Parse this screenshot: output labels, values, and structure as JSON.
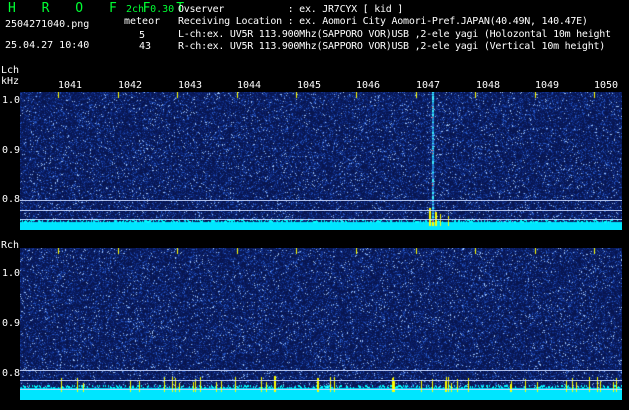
{
  "header": {
    "brand": "H R O F F T",
    "version": "2ch 0.30",
    "filename": "2504271040.png",
    "detection_type": "meteor",
    "datetime": "25.04.27 10:40",
    "count_lch": "5",
    "count_rch": "43"
  },
  "info": {
    "observer": "Ovserver           : ex. JR7CYX [ kid ]",
    "location": "Receiving Location : ex. Aomori City Aomori-Pref.JAPAN(40.49N, 140.47E)",
    "lch": "L-ch:ex. UV5R 113.900Mhz(SAPPORO VOR)USB ,2-ele yagi (Holozontal 10m height",
    "rch": "R-ch:ex. UV5R 113.900Mhz(SAPPORO VOR)USB ,2-ele yagi (Vertical 10m height)"
  },
  "lch_panel": {
    "label": "Lch",
    "unit": "kHz",
    "yticks": [
      "1.0",
      "0.9",
      "0.8"
    ]
  },
  "rch_panel": {
    "label": "Rch",
    "yticks": [
      "1.0",
      "0.9",
      "0.8"
    ]
  },
  "time_axis": {
    "ticks": [
      "1041",
      "1042",
      "1043",
      "1044",
      "1045",
      "1046",
      "1047",
      "1048",
      "1049",
      "1050"
    ]
  },
  "colors": {
    "brand": "#00ff33",
    "background": "#000000",
    "waterfall_base": "#0a1850",
    "noise_floor": "#00e5ff",
    "meteor_echo": "#ffff00"
  }
}
